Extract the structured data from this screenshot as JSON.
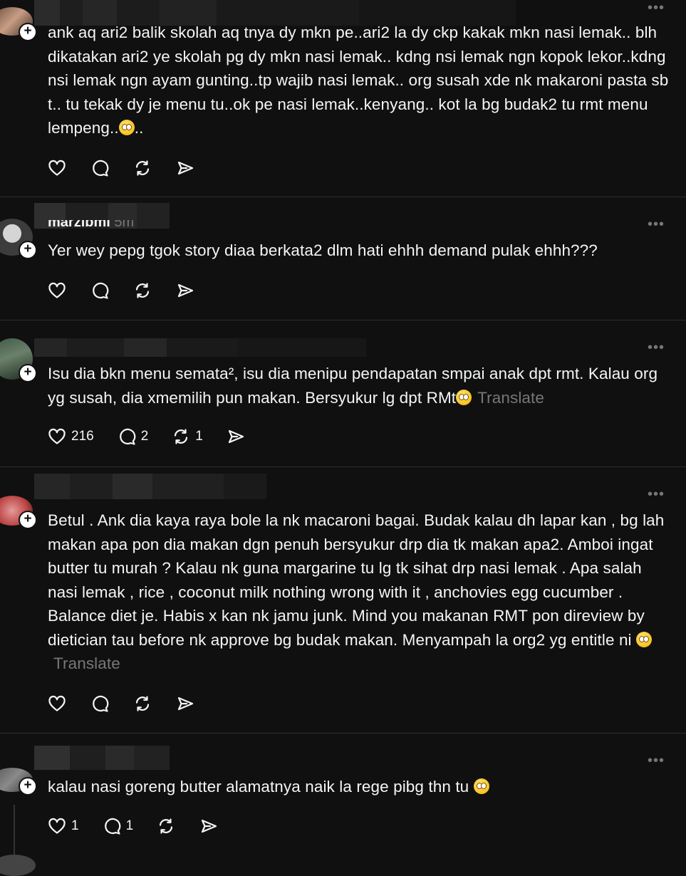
{
  "posts": [
    {
      "text": "ank aq ari2 balik skolah aq tnya dy mkn pe..ari2 la dy ckp kakak mkn nasi lemak.. blh dikatakan ari2 ye skolah pg dy mkn nasi lemak.. kdng nsi lemak ngn kopok lekor..kdng nsi lemak ngn ayam gunting..tp wajib nasi lemak.. org susah xde nk makaroni pasta sb t.. tu tekak dy je menu tu..ok pe nasi lemak..kenyang.. kot la bg budak2 tu rmt menu lempeng..",
      "tail": "..",
      "likes": "",
      "replies": "",
      "reposts": ""
    },
    {
      "username": "marzlbml",
      "time": "5m",
      "text": "Yer wey pepg tgok story diaa berkata2 dlm hati ehhh demand pulak ehhh???",
      "likes": "",
      "replies": "",
      "reposts": ""
    },
    {
      "text": "Isu dia bkn menu semata², isu dia menipu pendapatan smpai anak dpt rmt. Kalau org yg susah, dia xmemilih pun makan. Bersyukur lg dpt RMt",
      "translate": "Translate",
      "likes": "216",
      "replies": "2",
      "reposts": "1"
    },
    {
      "text": "Betul . Ank dia kaya raya bole la nk macaroni bagai. Budak kalau dh lapar kan , bg lah makan apa pon dia makan dgn penuh bersyukur drp dia tk makan apa2. Amboi ingat butter tu murah ? Kalau nk guna margarine tu lg tk sihat drp nasi lemak . Apa salah nasi lemak , rice , coconut milk nothing wrong with it , anchovies egg cucumber . Balance diet je. Habis x kan nk jamu junk. Mind you makanan RMT pon direview by dietician tau before nk approve bg budak makan. Menyampah la org2 yg entitle ni",
      "translate": "Translate",
      "likes": "",
      "replies": "",
      "reposts": ""
    },
    {
      "text": "kalau nasi goreng butter alamatnya naik la rege pibg thn tu",
      "likes": "1",
      "replies": "1",
      "reposts": ""
    }
  ],
  "icons": {
    "more": "more-icon",
    "like": "heart-icon",
    "reply": "comment-icon",
    "repost": "repost-icon",
    "share": "send-icon",
    "follow": "plus-icon"
  },
  "more_glyph": "•••",
  "plus_glyph": "+",
  "colors": {
    "bg": "#101010",
    "text": "#f3f5f7",
    "muted": "#777777",
    "divider": "#2d2d2d"
  }
}
